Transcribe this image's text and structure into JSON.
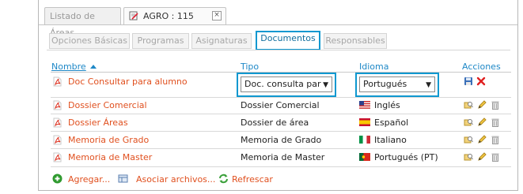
{
  "window_tabs": [
    {
      "label": "Listado de Áreas",
      "active": false
    },
    {
      "label": "AGRO : 115",
      "active": true,
      "close": "×"
    }
  ],
  "sub_tabs": [
    {
      "label": "Opciones Básicas"
    },
    {
      "label": "Programas"
    },
    {
      "label": "Asignaturas"
    },
    {
      "label": "Documentos",
      "active": true
    },
    {
      "label": "Responsables"
    }
  ],
  "table": {
    "headers": {
      "nombre": "Nombre",
      "tipo": "Tipo",
      "idioma": "Idioma",
      "acciones": "Acciones"
    },
    "edit_row": {
      "name": "Doc Consultar para alumno",
      "tipo_value": "Doc. consulta par",
      "idioma_value": "Portugués"
    },
    "rows": [
      {
        "name": "Dossier Comercial",
        "tipo": "Dossier Comercial",
        "idioma": "Inglés",
        "flag": "us-flag"
      },
      {
        "name": "Dossier Áreas",
        "tipo": "Dossier de área",
        "idioma": "Español",
        "flag": "es-flag"
      },
      {
        "name": "Memoria de Grado",
        "tipo": "Memoria de Grado",
        "idioma": "Italiano",
        "flag": "it-flag"
      },
      {
        "name": "Memoria de Master",
        "tipo": "Memoria de Master",
        "idioma": "Portugués (PT)",
        "flag": "pt-flag"
      }
    ]
  },
  "footer": {
    "add_label": "Agregar...",
    "associate_label": "Asociar archivos...",
    "refresh_label": "Refrescar"
  },
  "colors": {
    "accent": "#0f98d0",
    "link": "#e0501f",
    "header": "#1e88c7"
  }
}
